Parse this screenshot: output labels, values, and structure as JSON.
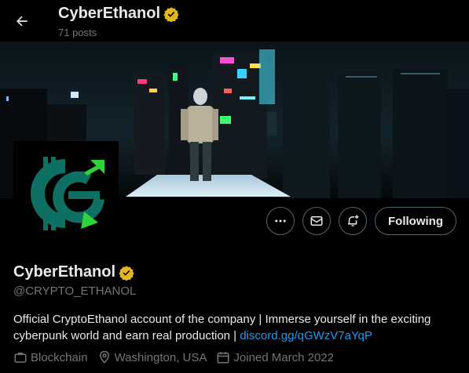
{
  "header": {
    "name": "CyberEthanol",
    "posts": "71 posts",
    "back_icon": "arrow-left-icon",
    "verified_icon": "verified-badge-icon"
  },
  "banner": {
    "description_icon": "cyberpunk-city-banner"
  },
  "avatar": {
    "icon": "cyberethanol-logo"
  },
  "actions": {
    "more_icon": "more-icon",
    "message_icon": "mail-icon",
    "notify_icon": "bell-plus-icon",
    "follow_label": "Following"
  },
  "profile": {
    "name": "CyberEthanol",
    "handle": "@CRYPTO_ETHANOL",
    "bio_text": "Official CryptoEthanol account of the company | Immerse yourself in the exciting cyberpunk world and earn real production | ",
    "bio_link": "discord.gg/qGWzV7aYqP",
    "category": "Blockchain",
    "location": "Washington, USA",
    "joined": "Joined March 2022"
  },
  "colors": {
    "background": "#000000",
    "text": "#e7e9ea",
    "muted": "#71767b",
    "link": "#1d9bf0",
    "verified": "#e2b719",
    "logo_teal": "#0e6f63",
    "logo_green": "#2fd33a"
  }
}
